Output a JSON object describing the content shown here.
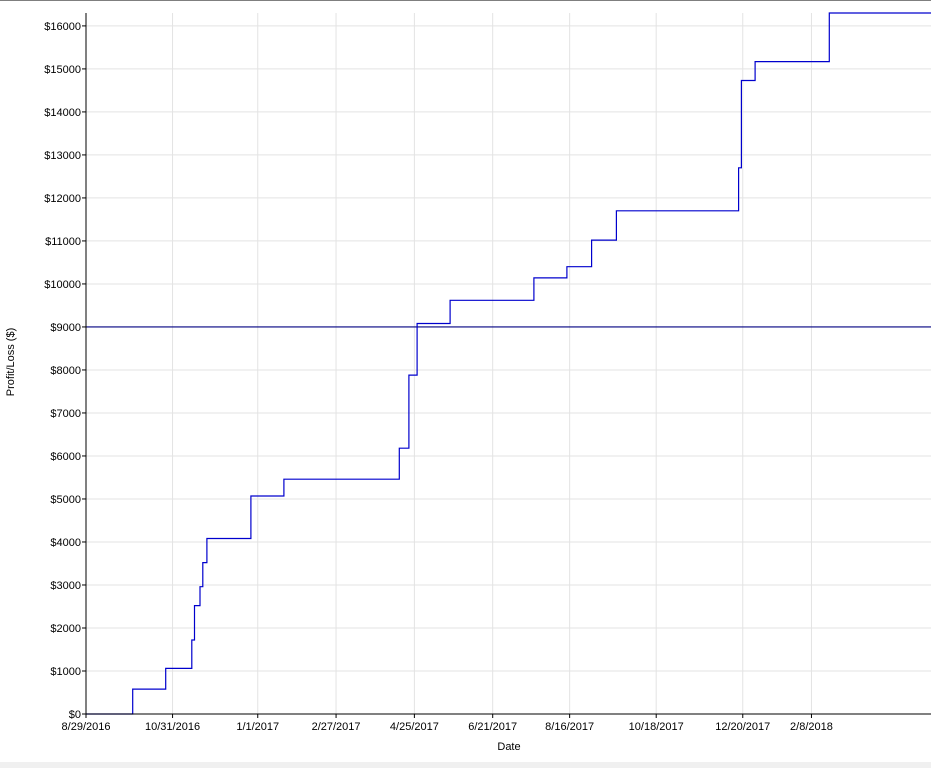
{
  "chart_data": {
    "type": "line",
    "title": "",
    "xlabel": "Date",
    "ylabel": "Profit/Loss ($)",
    "x_tick_labels": [
      "8/29/2016",
      "10/31/2016",
      "1/1/2017",
      "2/27/2017",
      "4/25/2017",
      "6/21/2017",
      "8/16/2017",
      "10/18/2017",
      "12/20/2017",
      "2/8/2018"
    ],
    "x_tick_dates": [
      "2016-08-29",
      "2016-10-31",
      "2017-01-01",
      "2017-02-27",
      "2017-04-25",
      "2017-06-21",
      "2017-08-16",
      "2017-10-18",
      "2017-12-20",
      "2018-02-08"
    ],
    "xlim": [
      "2016-08-29",
      "2018-05-06"
    ],
    "y_tick_labels": [
      "$0",
      "$1000",
      "$2000",
      "$3000",
      "$4000",
      "$5000",
      "$6000",
      "$7000",
      "$8000",
      "$9000",
      "$10000",
      "$11000",
      "$12000",
      "$13000",
      "$14000",
      "$15000",
      "$16000"
    ],
    "ylim": [
      0,
      16300
    ],
    "grid": true,
    "reference_line": {
      "y": 9000,
      "color": "#000080"
    },
    "line_color": "#0000cd",
    "step": true,
    "series": [
      {
        "points": [
          {
            "x": "2016-08-29",
            "y": 0
          },
          {
            "x": "2016-10-02",
            "y": 580
          },
          {
            "x": "2016-10-26",
            "y": 1060
          },
          {
            "x": "2016-11-14",
            "y": 1720
          },
          {
            "x": "2016-11-16",
            "y": 2520
          },
          {
            "x": "2016-11-20",
            "y": 2960
          },
          {
            "x": "2016-11-22",
            "y": 3520
          },
          {
            "x": "2016-11-25",
            "y": 4080
          },
          {
            "x": "2016-12-27",
            "y": 5070
          },
          {
            "x": "2017-01-20",
            "y": 5460
          },
          {
            "x": "2017-04-14",
            "y": 6180
          },
          {
            "x": "2017-04-21",
            "y": 7880
          },
          {
            "x": "2017-04-27",
            "y": 9080
          },
          {
            "x": "2017-05-21",
            "y": 9620
          },
          {
            "x": "2017-07-21",
            "y": 10140
          },
          {
            "x": "2017-08-14",
            "y": 10400
          },
          {
            "x": "2017-09-01",
            "y": 11020
          },
          {
            "x": "2017-09-19",
            "y": 11700
          },
          {
            "x": "2017-12-17",
            "y": 12700
          },
          {
            "x": "2017-12-19",
            "y": 14730
          },
          {
            "x": "2017-12-29",
            "y": 15170
          },
          {
            "x": "2018-02-21",
            "y": 16300
          },
          {
            "x": "2018-05-06",
            "y": 16300
          }
        ]
      }
    ]
  }
}
